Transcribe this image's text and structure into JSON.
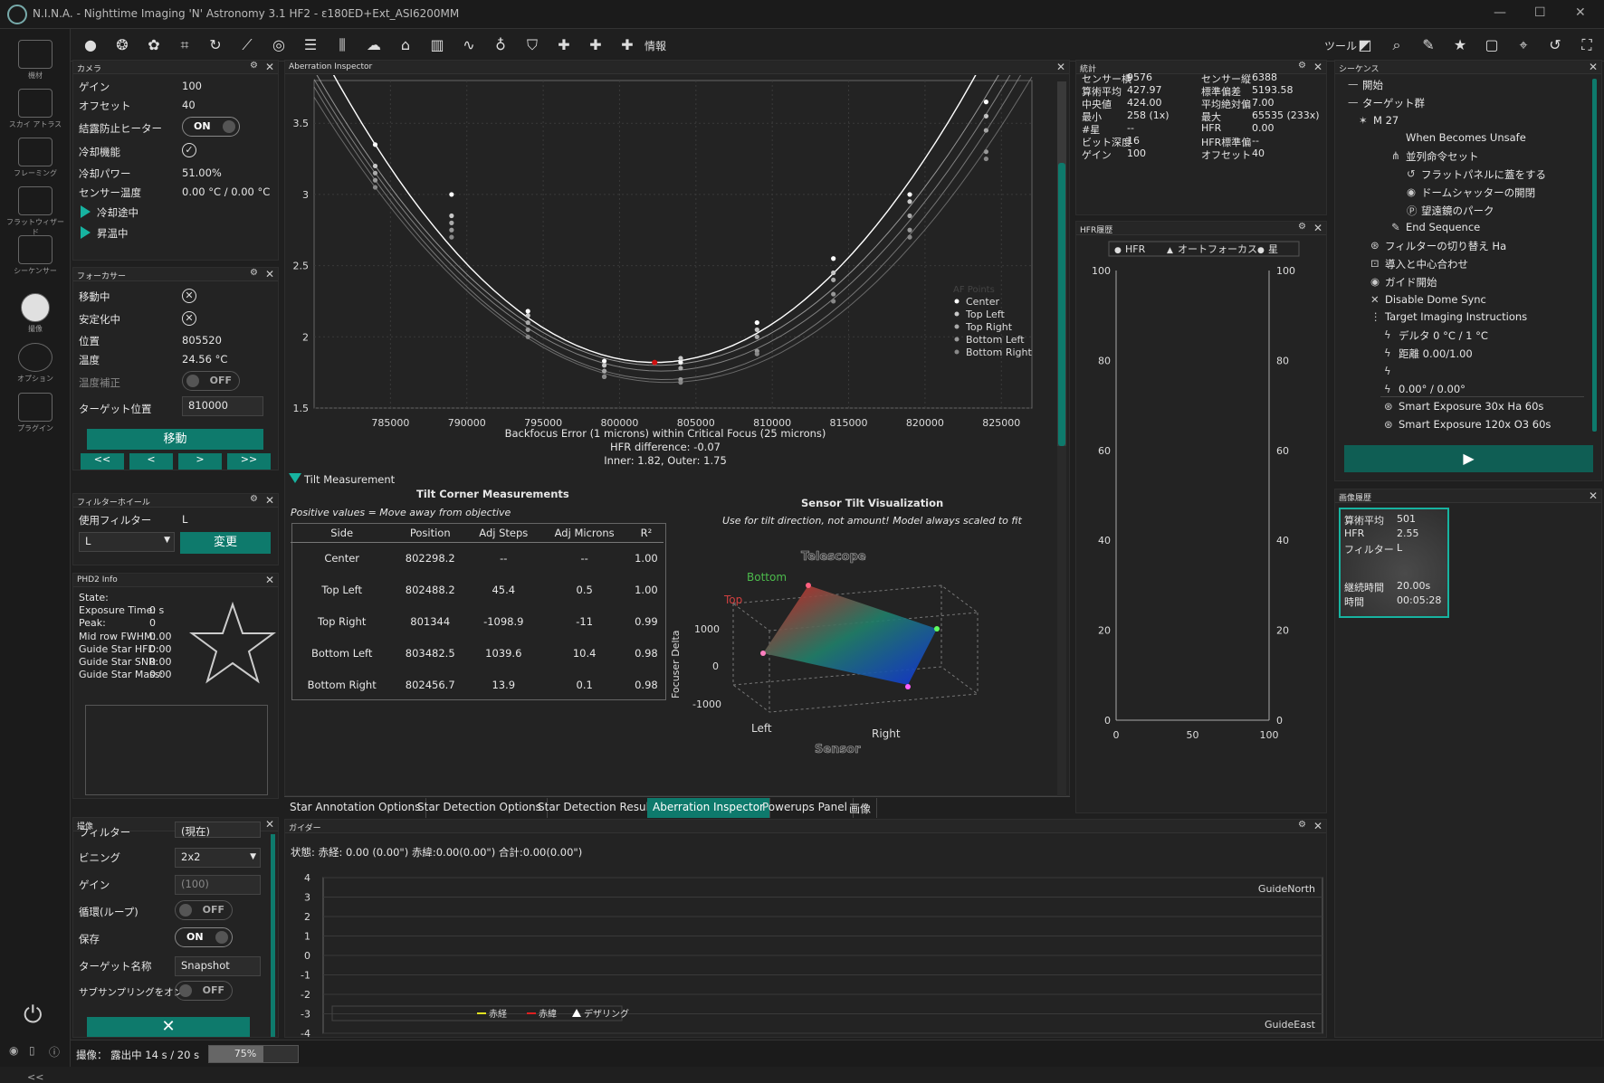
{
  "window": {
    "title": "N.I.N.A. - Nighttime Imaging 'N' Astronomy 3.1 HF2   -  ε180ED+Ext_ASI6200MM"
  },
  "nav": [
    "機材",
    "スカイ アトラス",
    "フレーミング",
    "フラットウィザード",
    "シーケンサー",
    "撮像",
    "オプション",
    "プラグイン"
  ],
  "toolbar": {
    "info_label": "情報",
    "tools_label": "ツール"
  },
  "camera": {
    "header": "カメラ",
    "gain_label": "ゲイン",
    "gain": "100",
    "offset_label": "オフセット",
    "offset": "40",
    "dew_label": "結露防止ヒーター",
    "dew": "ON",
    "cooler_label": "冷却機能",
    "power_label": "冷却パワー",
    "power": "51.00%",
    "temp_label": "センサー温度",
    "temp": "0.00 °C / 0.00 °C",
    "cooling": "冷却途中",
    "warming": "昇温中"
  },
  "focuser": {
    "header": "フォーカサー",
    "moving_label": "移動中",
    "settling_label": "安定化中",
    "position_label": "位置",
    "position": "805520",
    "temp_label": "温度",
    "temp": "24.56 °C",
    "comp_label": "温度補正",
    "comp": "OFF",
    "target_label": "ターゲット位置",
    "target": "810000",
    "move_btn": "移動",
    "b1": "<<",
    "b2": "<",
    "b3": ">",
    "b4": ">>"
  },
  "filterwheel": {
    "header": "フィルターホイール",
    "current_label": "使用フィルター",
    "current": "L",
    "select": "L",
    "change_btn": "変更"
  },
  "phd2": {
    "header": "PHD2 Info",
    "labels": [
      "State:",
      "Exposure Time:",
      "Peak:",
      "Mid row FWHM:",
      "Guide Star HFD:",
      "Guide Star SNR:",
      "Guide Star Mass:"
    ],
    "values": [
      "",
      "0 s",
      "0",
      "0.00",
      "0.00",
      "0.00",
      "0.00"
    ]
  },
  "imaging": {
    "header": "撮像",
    "filter_label": "フィルター",
    "filter": "(現在)",
    "binning_label": "ビニング",
    "binning": "2x2",
    "gain_label": "ゲイン",
    "gain": "(100)",
    "loop_label": "循環(ループ)",
    "loop": "OFF",
    "save_label": "保存",
    "save": "ON",
    "target_label": "ターゲット名称",
    "target": "Snapshot",
    "subsample_label": "サブサンプリングをオン",
    "subsample": "OFF"
  },
  "aberration": {
    "header": "Aberration Inspector",
    "summary1": "Backfocus Error (1 microns) within Critical Focus (25 microns)",
    "summary2": "HFR difference: -0.07",
    "summary3": "Inner: 1.82, Outer: 1.75",
    "tilt_toggle": "Tilt Measurement",
    "table_title": "Tilt Corner Measurements",
    "table_note": "Positive values = Move away from objective",
    "columns": [
      "Side",
      "Position",
      "Adj Steps",
      "Adj Microns",
      "R²"
    ],
    "rows": [
      [
        "Center",
        "802298.2",
        "--",
        "--",
        "1.00"
      ],
      [
        "Top Left",
        "802488.2",
        "45.4",
        "0.5",
        "1.00"
      ],
      [
        "Top Right",
        "801344",
        "-1098.9",
        "-11",
        "0.99"
      ],
      [
        "Bottom Left",
        "803482.5",
        "1039.6",
        "10.4",
        "0.98"
      ],
      [
        "Bottom Right",
        "802456.7",
        "13.9",
        "0.1",
        "0.98"
      ]
    ],
    "viz_title": "Sensor Tilt Visualization",
    "viz_note": "Use for tilt direction, not amount! Model always scaled to fit",
    "viz_labels": {
      "telescope": "Telescope",
      "sensor": "Sensor",
      "bottom": "Bottom",
      "top": "Top",
      "left": "Left",
      "right": "Right",
      "focuser": "Focuser Delta",
      "z1": "1000",
      "z0": "0",
      "zm": "-1000"
    }
  },
  "chart_data": [
    {
      "type": "scatter",
      "title": "",
      "xlabel": "",
      "ylabel": "",
      "xlim": [
        780000,
        827000
      ],
      "ylim": [
        1.5,
        3.8
      ],
      "xticks": [
        "785000",
        "790000",
        "795000",
        "800000",
        "805000",
        "810000",
        "815000",
        "820000",
        "825000"
      ],
      "yticks": [
        "1.5",
        "2",
        "2.5",
        "3",
        "3.5"
      ],
      "legend": {
        "position": "bottom-right",
        "title": "AF Points",
        "entries": [
          "Center",
          "Top Left",
          "Top Right",
          "Bottom Left",
          "Bottom Right"
        ]
      },
      "x": [
        784000,
        789000,
        794000,
        799000,
        804000,
        809000,
        814000,
        819000,
        824000
      ],
      "series": [
        {
          "name": "Center",
          "values": [
            3.35,
            3.0,
            2.18,
            1.83,
            1.82,
            2.1,
            2.55,
            3.0,
            3.65
          ]
        },
        {
          "name": "Top Left",
          "values": [
            3.2,
            2.85,
            2.15,
            1.8,
            1.85,
            2.05,
            2.45,
            2.95,
            3.55
          ]
        },
        {
          "name": "Top Right",
          "values": [
            3.15,
            2.8,
            2.1,
            1.76,
            1.78,
            2.0,
            2.4,
            2.85,
            3.45
          ]
        },
        {
          "name": "Bottom Left",
          "values": [
            3.1,
            2.75,
            2.05,
            1.72,
            1.7,
            1.9,
            2.3,
            2.75,
            3.3
          ]
        },
        {
          "name": "Bottom Right",
          "values": [
            3.05,
            2.7,
            2.0,
            1.72,
            1.68,
            1.88,
            2.25,
            2.7,
            3.25
          ]
        }
      ]
    },
    {
      "type": "line",
      "title": "HFR履歴",
      "legend": {
        "position": "top",
        "entries": [
          "HFR",
          "オートフォーカス",
          "星"
        ]
      },
      "xlim": [
        0,
        100
      ],
      "ylim": [
        0,
        100
      ],
      "xticks": [
        "0",
        "50",
        "100"
      ],
      "yticks": [
        "0",
        "20",
        "40",
        "60",
        "80",
        "100"
      ],
      "series": []
    },
    {
      "type": "line",
      "title": "",
      "ylim": [
        -4,
        4
      ],
      "yticks": [
        "4",
        "3",
        "2",
        "1",
        "0",
        "-1",
        "-2",
        "-3",
        "-4"
      ],
      "labels": {
        "north": "GuideNorth",
        "east": "GuideEast"
      },
      "legend": {
        "position": "bottom-left",
        "entries": [
          "赤経",
          "赤緯",
          "デザリング"
        ]
      },
      "series": []
    }
  ],
  "stats": {
    "header": "統計",
    "left": [
      [
        "センサー横",
        "9576"
      ],
      [
        "算術平均",
        "427.97"
      ],
      [
        "中央値",
        "424.00"
      ],
      [
        "最小",
        "258 (1x)"
      ],
      [
        "#星",
        "--"
      ],
      [
        "ビット深度",
        "16"
      ],
      [
        "ゲイン",
        "100"
      ]
    ],
    "right": [
      [
        "センサー縦",
        "6388"
      ],
      [
        "標準偏差",
        "5193.58"
      ],
      [
        "平均絶対偏",
        "7.00"
      ],
      [
        "最大",
        "65535 (233x)"
      ],
      [
        "HFR",
        "0.00"
      ],
      [
        "HFR標準偏",
        "--"
      ],
      [
        "オフセット",
        "40"
      ]
    ]
  },
  "hfr": {
    "header": "HFR履歴"
  },
  "sequence": {
    "header": "シーケンス",
    "items": [
      "開始",
      "ターゲット群",
      "M 27",
      "When Becomes Unsafe",
      "並列命令セット",
      "フラットパネルに蓋をする",
      "ドームシャッターの開閉",
      "望遠鏡のパーク",
      "End Sequence",
      "フィルターの切り替え Ha",
      "導入と中心合わせ",
      "ガイド開始",
      "Disable Dome Sync",
      "Target Imaging Instructions",
      "デルタ 0 °C / 1 °C",
      "距離 0.00/1.00",
      "",
      "0.00° / 0.00°",
      "Smart Exposure 30x Ha 60s",
      "Smart Exposure 120x O3 60s"
    ]
  },
  "history": {
    "header": "画像履歴",
    "rows": [
      [
        "算術平均",
        "501"
      ],
      [
        "HFR",
        "2.55"
      ],
      [
        "フィルター",
        "L"
      ],
      [
        "継続時間",
        "20.00s"
      ],
      [
        "時間",
        "00:05:28"
      ]
    ]
  },
  "tabs": [
    "Star Annotation Options",
    "Star Detection Options",
    "Star Detection Results",
    "Aberration Inspector",
    "Powerups Panel",
    "画像"
  ],
  "guider": {
    "header": "ガイダー",
    "status": "状態:  赤経: 0.00 (0.00\")  赤緯:0.00(0.00\")  合計:0.00(0.00\")",
    "legend": [
      "赤経",
      "赤緯",
      "デザリング"
    ],
    "north": "GuideNorth",
    "east": "GuideEast"
  },
  "status": {
    "text": "撮像： 露出中 14 s / 20 s",
    "progress": 75,
    "progress_label": "75%"
  },
  "colors": {
    "accent": "#0e7a6c",
    "accent_bright": "#17b3a0"
  }
}
